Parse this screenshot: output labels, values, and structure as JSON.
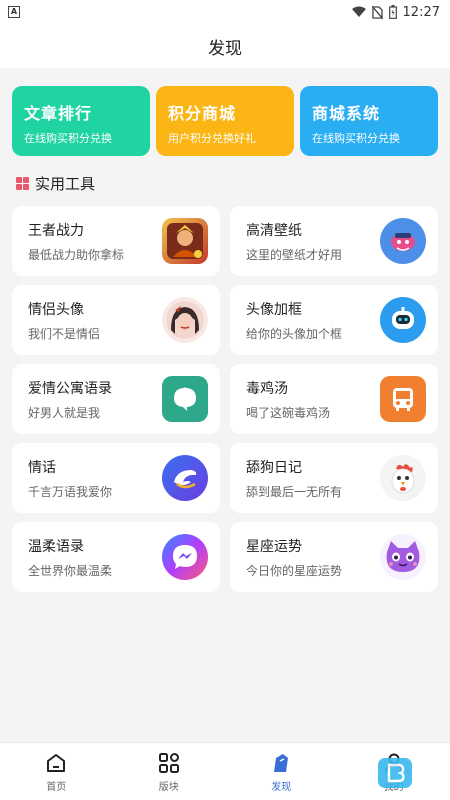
{
  "status": {
    "time": "12:27",
    "app_glyph": "A"
  },
  "header": {
    "title": "发现"
  },
  "banners": [
    {
      "title": "文章排行",
      "sub": "在线购买积分兑换",
      "color": "#1fd4a2"
    },
    {
      "title": "积分商城",
      "sub": "用户积分兑换好礼",
      "color": "#fbb514"
    },
    {
      "title": "商城系统",
      "sub": "在线购买积分兑换",
      "color": "#2aaef3"
    }
  ],
  "section": {
    "title": "实用工具",
    "icon": "grid-icon"
  },
  "tools": [
    {
      "title": "王者战力",
      "sub": "最低战力助你拿标",
      "icon": "game-hero-icon"
    },
    {
      "title": "高清壁纸",
      "sub": "这里的壁纸才好用",
      "icon": "wallpaper-icon"
    },
    {
      "title": "情侣头像",
      "sub": "我们不是情侣",
      "icon": "avatar-girl-icon"
    },
    {
      "title": "头像加框",
      "sub": "给你的头像加个框",
      "icon": "robot-frame-icon"
    },
    {
      "title": "爱情公寓语录",
      "sub": "好男人就是我",
      "icon": "chat-bubble-icon"
    },
    {
      "title": "毒鸡汤",
      "sub": "喝了这碗毒鸡汤",
      "icon": "bus-icon"
    },
    {
      "title": "情话",
      "sub": "千言万语我爱你",
      "icon": "dolphin-icon"
    },
    {
      "title": "舔狗日记",
      "sub": "舔到最后一无所有",
      "icon": "rooster-icon"
    },
    {
      "title": "温柔语录",
      "sub": "全世界你最温柔",
      "icon": "messenger-icon"
    },
    {
      "title": "星座运势",
      "sub": "今日你的星座运势",
      "icon": "purple-cat-icon"
    }
  ],
  "tabbar": [
    {
      "label": "首页",
      "icon": "home-icon"
    },
    {
      "label": "版块",
      "icon": "grid-apps-icon"
    },
    {
      "label": "发现",
      "icon": "discover-icon",
      "active": true
    },
    {
      "label": "我的",
      "icon": "user-icon"
    }
  ],
  "colors": {
    "accent": "#3a6ed6",
    "background": "#f4f4f4"
  }
}
